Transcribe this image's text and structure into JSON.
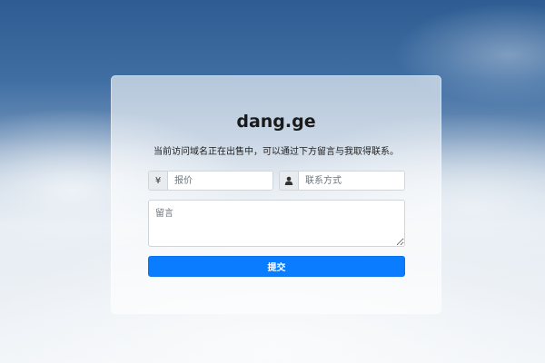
{
  "page": {
    "title": "dang.ge",
    "subtitle": "当前访问域名正在出售中，可以通过下方留言与我取得联系。"
  },
  "form": {
    "price": {
      "prefix_symbol": "¥",
      "placeholder": "报价",
      "value": ""
    },
    "contact": {
      "icon": "user-icon",
      "placeholder": "联系方式",
      "value": ""
    },
    "message": {
      "placeholder": "留言",
      "value": ""
    },
    "submit_label": "提交"
  },
  "colors": {
    "accent": "#0a7cff",
    "addon_bg": "#e9ecef"
  }
}
